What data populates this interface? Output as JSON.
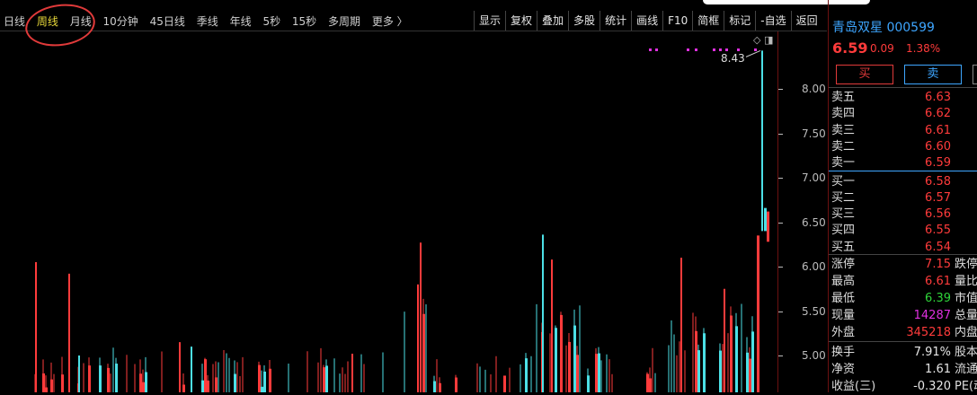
{
  "period_tabs": [
    "日线",
    "周线",
    "月线",
    "10分钟",
    "45日线",
    "季线",
    "年线",
    "5秒",
    "15秒",
    "多周期",
    "更多 〉"
  ],
  "active_period": "周线",
  "tool_buttons": [
    "显示",
    "复权",
    "叠加",
    "多股",
    "统计",
    "画线",
    "F10",
    "简框",
    "标记",
    "-自选",
    "返回"
  ],
  "colors": {
    "up": "#ff3b3b",
    "down": "#4ce0e6",
    "accent_yellow": "#e8d83a",
    "blue": "#3ea6ff",
    "green": "#2fd43a",
    "magenta": "#e030e0"
  },
  "chart": {
    "price_ticks": [
      "8.00",
      "7.50",
      "7.00",
      "6.50",
      "6.00",
      "5.50",
      "5.00"
    ],
    "max_label": "8.43",
    "axis_icons": "◇ ◨"
  },
  "stock": {
    "name": "青岛双星",
    "code": "000599",
    "price": "6.59",
    "change": "0.09",
    "change_pct": "1.38%"
  },
  "trade": {
    "buy": "买",
    "sell": "卖"
  },
  "order_book": [
    {
      "label": "卖五",
      "price": "6.63"
    },
    {
      "label": "卖四",
      "price": "6.62"
    },
    {
      "label": "卖三",
      "price": "6.61"
    },
    {
      "label": "卖二",
      "price": "6.60"
    },
    {
      "label": "卖一",
      "price": "6.59"
    },
    {
      "label": "买一",
      "price": "6.58"
    },
    {
      "label": "买二",
      "price": "6.57"
    },
    {
      "label": "买三",
      "price": "6.56"
    },
    {
      "label": "买四",
      "price": "6.55"
    },
    {
      "label": "买五",
      "price": "6.54"
    }
  ],
  "stats": [
    {
      "label": "涨停",
      "value": "7.15",
      "color": "up",
      "right": "跌停"
    },
    {
      "label": "最高",
      "value": "6.61",
      "color": "up",
      "right": "量比"
    },
    {
      "label": "最低",
      "value": "6.39",
      "color": "green",
      "right": "市值"
    },
    {
      "label": "现量",
      "value": "14287",
      "color": "magenta",
      "right": "总量"
    },
    {
      "label": "外盘",
      "value": "345218",
      "color": "up",
      "right": "内盘"
    },
    {
      "label": "换手",
      "value": "7.91%",
      "color": "white",
      "right": "股本"
    },
    {
      "label": "净资",
      "value": "1.61",
      "color": "white",
      "right": "流通"
    },
    {
      "label": "收益(三)",
      "value": "-0.320",
      "color": "white",
      "right": "PE(动"
    }
  ]
}
